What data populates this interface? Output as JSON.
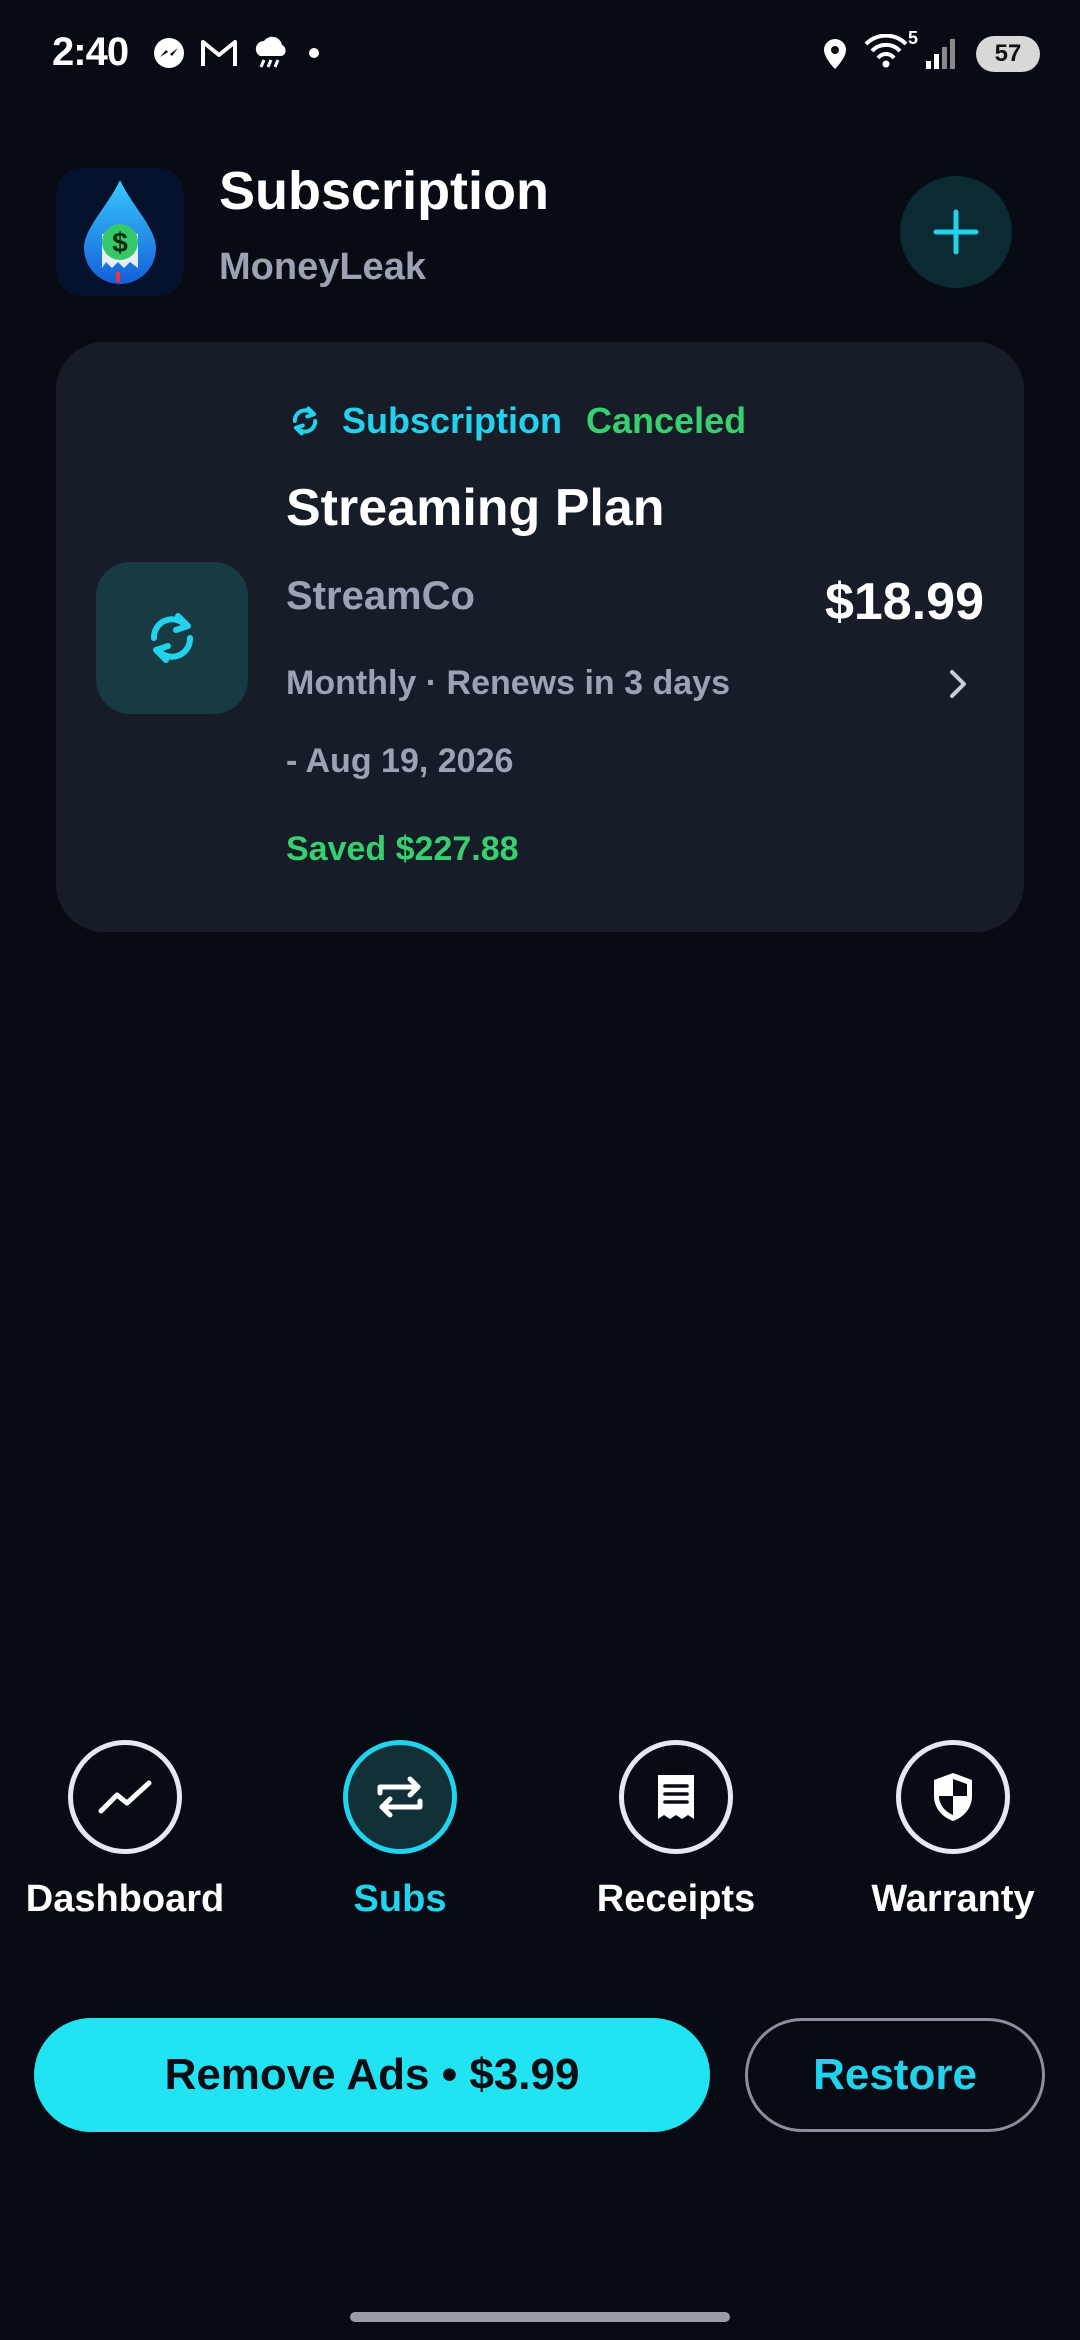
{
  "status_bar": {
    "time": "2:40",
    "battery": "57",
    "icons": [
      "messenger-icon",
      "gmail-icon",
      "weather-icon",
      "dot-icon",
      "location-icon",
      "wifi-icon",
      "signal-icon"
    ],
    "wifi_badge": "5"
  },
  "header": {
    "title": "Subscription",
    "subtitle": "MoneyLeak",
    "add_icon": "plus-icon"
  },
  "subscription": {
    "type_label": "Subscription",
    "status": "Canceled",
    "name": "Streaming Plan",
    "company": "StreamCo",
    "price": "$18.99",
    "schedule": "Monthly · Renews in 3 days",
    "end_date": "- Aug 19, 2026",
    "saved": "Saved $227.88"
  },
  "nav": {
    "items": [
      {
        "label": "Dashboard",
        "icon": "trend-icon",
        "active": false
      },
      {
        "label": "Subs",
        "icon": "repeat-icon",
        "active": true
      },
      {
        "label": "Receipts",
        "icon": "receipt-icon",
        "active": false
      },
      {
        "label": "Warranty",
        "icon": "shield-icon",
        "active": false
      }
    ]
  },
  "actions": {
    "remove_ads": "Remove Ads • $3.99",
    "restore": "Restore"
  },
  "colors": {
    "background": "#080b13",
    "card": "#171c29",
    "accent": "#22d3ee",
    "success": "#36d16e",
    "muted": "#9aa2b4"
  }
}
